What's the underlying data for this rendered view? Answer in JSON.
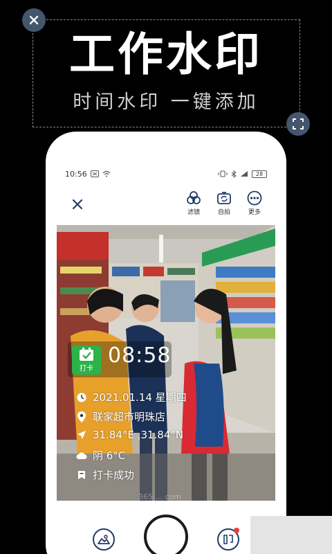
{
  "promo": {
    "headline": "工作水印",
    "subline": "时间水印 一键添加"
  },
  "statusbar": {
    "time": "10:56",
    "battery": "28"
  },
  "toolbar": {
    "filter_label": "滤镜",
    "selfie_label": "自拍",
    "more_label": "更多"
  },
  "watermark": {
    "badge_label": "打卡",
    "time": "08:58",
    "date": "2021.01.14 星期四",
    "location": "联家超市明珠店",
    "coordinates": "31.84°E ,31.84°N",
    "weather": "阴 6°C",
    "status": "打卡成功"
  },
  "photo_overlay_text": "365 ... com",
  "colors": {
    "accent_navy": "#1f3b66",
    "badge_green": "#2bb34a",
    "notify_red": "#e83b3b"
  }
}
